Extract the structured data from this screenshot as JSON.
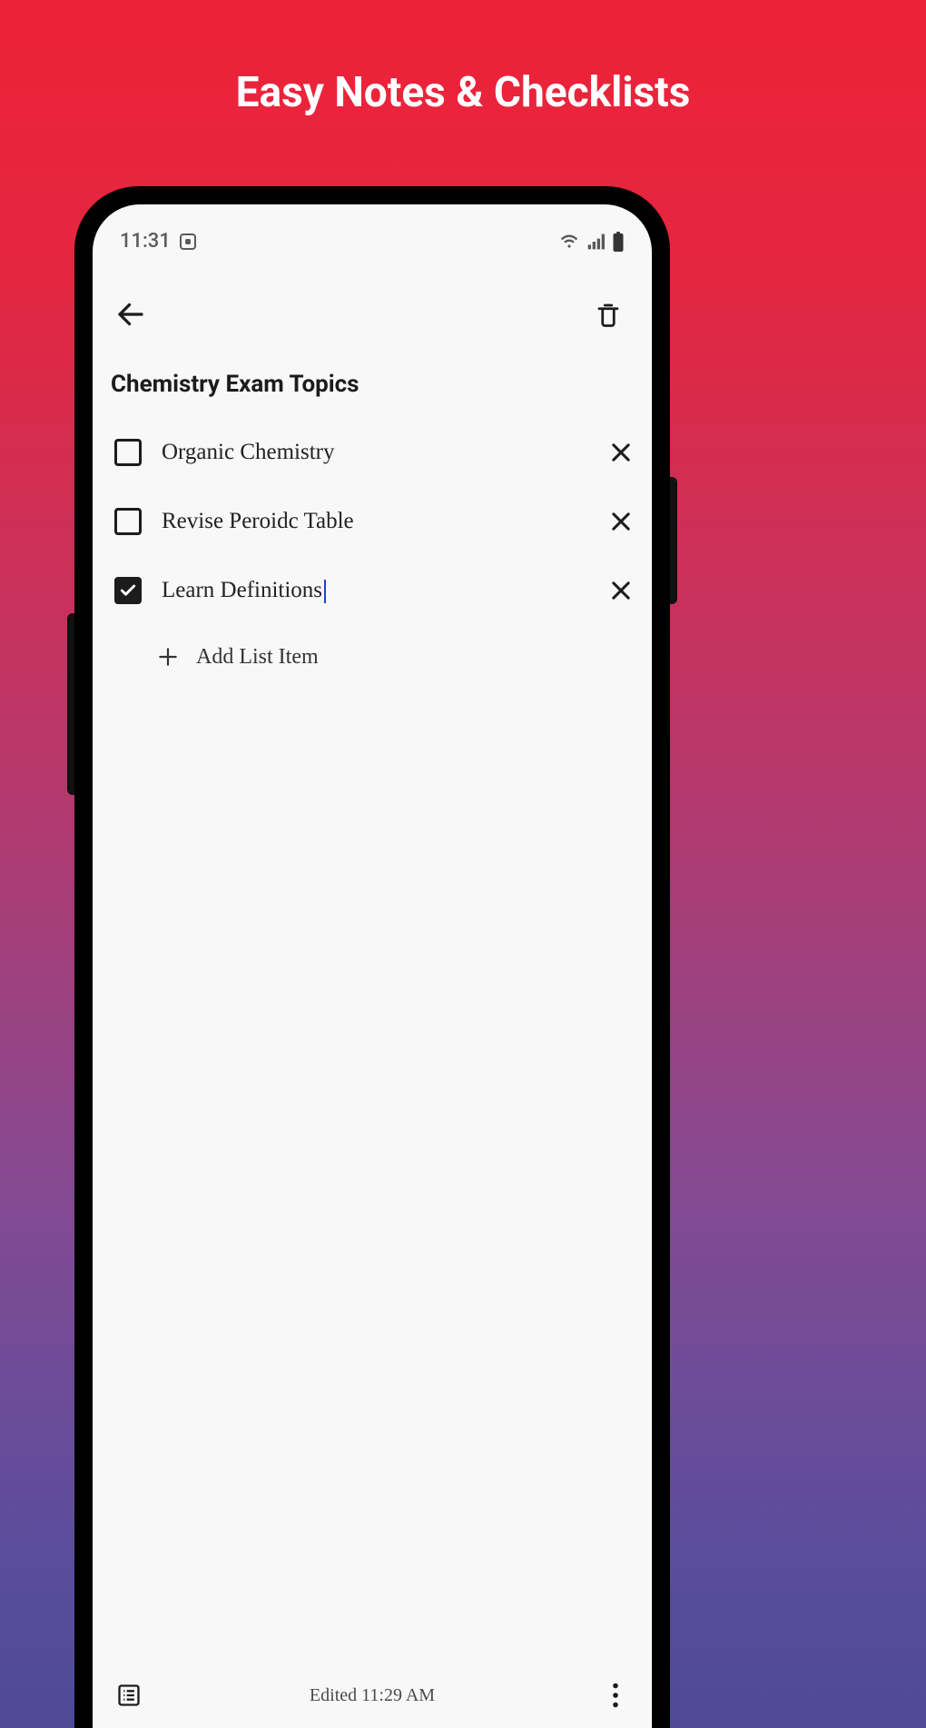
{
  "promo": {
    "headline": "Easy Notes & Checklists"
  },
  "status": {
    "time": "11:31"
  },
  "note": {
    "title": "Chemistry Exam Topics",
    "items": [
      {
        "text": "Organic Chemistry",
        "checked": false,
        "editing": false
      },
      {
        "text": "Revise Peroidc Table",
        "checked": false,
        "editing": false
      },
      {
        "text": "Learn Definitions",
        "checked": true,
        "editing": true
      }
    ],
    "add_label": "Add List Item"
  },
  "footer": {
    "edited": "Edited 11:29 AM"
  }
}
